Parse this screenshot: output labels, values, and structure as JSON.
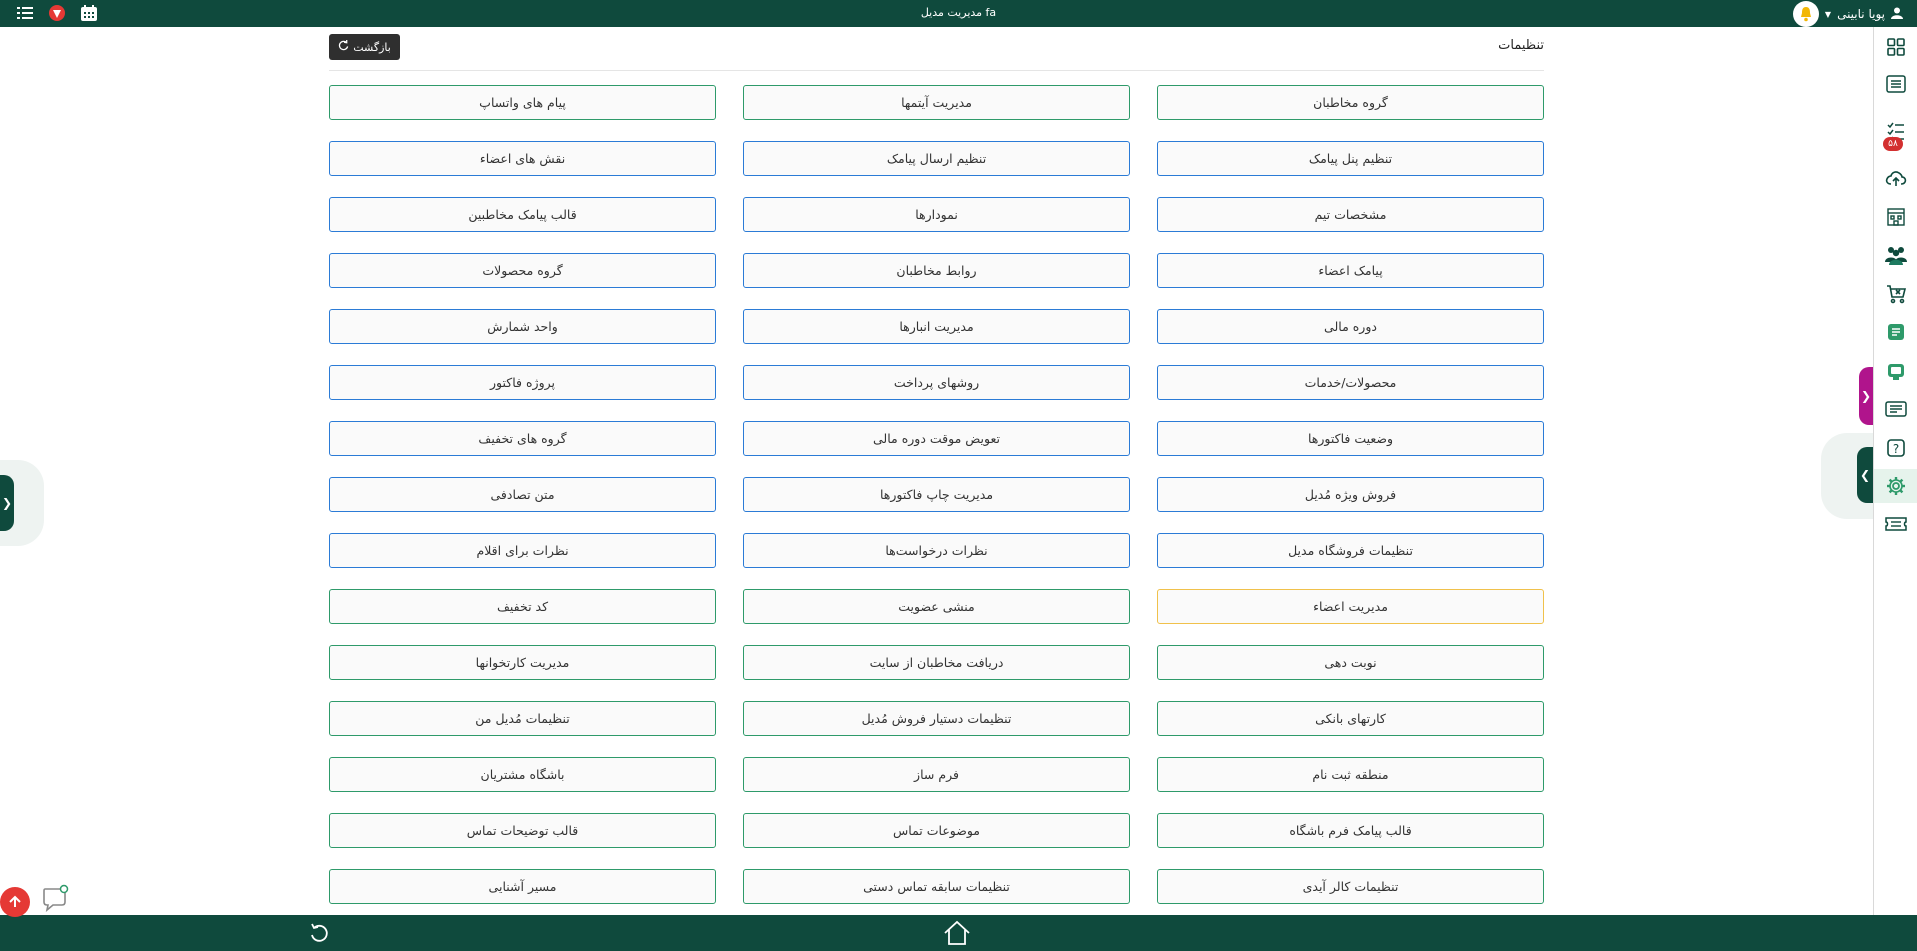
{
  "topbar": {
    "title": "مدیریت مدیل fa",
    "user_name": "پویا نابینی",
    "icons": [
      "list-icon",
      "logo-icon",
      "calendar-icon",
      "user-icon",
      "bell-icon",
      "caret-down-icon"
    ]
  },
  "header": {
    "title": "تنظیمات",
    "back_label": "بازگشت"
  },
  "sidebar": {
    "badge": "۵۸",
    "items": [
      "grid-icon",
      "document-icon",
      "checklist-icon",
      "cloud-upload-icon",
      "building-icon",
      "team-icon",
      "cart-icon",
      "receipt-icon",
      "device-icon",
      "id-card-icon",
      "help-icon",
      "settings-icon",
      "ticket-icon"
    ]
  },
  "settings": [
    {
      "label": "گروه مخاطبان",
      "color": "#2e9a6a"
    },
    {
      "label": "مدیریت آیتمها",
      "color": "#2e9a6a"
    },
    {
      "label": "پیام های واتساپ",
      "color": "#2e9a6a"
    },
    {
      "label": "تنظیم پنل پیامک",
      "color": "#2b7bd6"
    },
    {
      "label": "تنظیم ارسال پیامک",
      "color": "#2b7bd6"
    },
    {
      "label": "نقش های اعضاء",
      "color": "#2b7bd6"
    },
    {
      "label": "مشخصات تیم",
      "color": "#2b7bd6"
    },
    {
      "label": "نمودارها",
      "color": "#2b7bd6"
    },
    {
      "label": "قالب پیامک مخاطبین",
      "color": "#2b7bd6"
    },
    {
      "label": "پیامک اعضاء",
      "color": "#2b7bd6"
    },
    {
      "label": "روابط مخاطبان",
      "color": "#2b7bd6"
    },
    {
      "label": "گروه محصولات",
      "color": "#2b7bd6"
    },
    {
      "label": "دوره مالی",
      "color": "#2b7bd6"
    },
    {
      "label": "مدیریت انبارها",
      "color": "#2b7bd6"
    },
    {
      "label": "واحد شمارش",
      "color": "#2b7bd6"
    },
    {
      "label": "محصولات/خدمات",
      "color": "#2b7bd6"
    },
    {
      "label": "روشهای پرداخت",
      "color": "#2b7bd6"
    },
    {
      "label": "پروژه فاکتور",
      "color": "#2b7bd6"
    },
    {
      "label": "وضعیت فاکتورها",
      "color": "#2b7bd6"
    },
    {
      "label": "تعویض موقت دوره مالی",
      "color": "#2b7bd6"
    },
    {
      "label": "گروه های تخفیف",
      "color": "#2b7bd6"
    },
    {
      "label": "فروش ویژه مُدیل",
      "color": "#2b7bd6"
    },
    {
      "label": "مدیریت چاپ فاکتورها",
      "color": "#2b7bd6"
    },
    {
      "label": "متن تصادفی",
      "color": "#2b7bd6"
    },
    {
      "label": "تنظیمات فروشگاه مدیل",
      "color": "#2b7bd6"
    },
    {
      "label": "نظرات درخواست‌ها",
      "color": "#2b7bd6"
    },
    {
      "label": "نظرات برای اقلام",
      "color": "#2b7bd6"
    },
    {
      "label": "مدیریت اعضاء",
      "color": "#f0c14b"
    },
    {
      "label": "منشی عضویت",
      "color": "#2e9a6a"
    },
    {
      "label": "کد تخفیف",
      "color": "#2e9a6a"
    },
    {
      "label": "نوبت دهی",
      "color": "#2e9a6a"
    },
    {
      "label": "دریافت مخاطبان از سایت",
      "color": "#2e9a6a"
    },
    {
      "label": "مدیریت کارتخوانها",
      "color": "#2e9a6a"
    },
    {
      "label": "کارتهای بانکی",
      "color": "#2e9a6a"
    },
    {
      "label": "تنظیمات دستیار فروش مُدیل",
      "color": "#2e9a6a"
    },
    {
      "label": "تنظیمات مُدیل من",
      "color": "#2e9a6a"
    },
    {
      "label": "منطقه ثبت نام",
      "color": "#2e9a6a"
    },
    {
      "label": "فرم ساز",
      "color": "#2e9a6a"
    },
    {
      "label": "باشگاه مشتریان",
      "color": "#2e9a6a"
    },
    {
      "label": "قالب پیامک فرم باشگاه",
      "color": "#2e9a6a"
    },
    {
      "label": "موضوعات تماس",
      "color": "#2e9a6a"
    },
    {
      "label": "قالب توضیحات تماس",
      "color": "#2e9a6a"
    },
    {
      "label": "تنظیمات کالر آیدی",
      "color": "#2e9a6a"
    },
    {
      "label": "تنظیمات سابقه تماس دستی",
      "color": "#2e9a6a"
    },
    {
      "label": "مسیر آشنایی",
      "color": "#2e9a6a"
    }
  ],
  "colors": {
    "brand": "#0f4a3d",
    "accent_green": "#2e9a6a",
    "accent_blue": "#2b7bd6",
    "highlight": "#f0c14b",
    "danger": "#e53935"
  }
}
